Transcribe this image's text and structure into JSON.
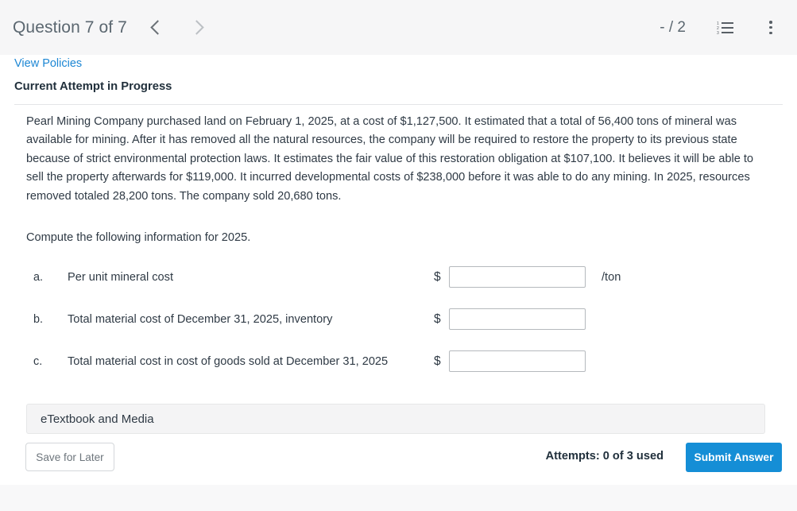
{
  "header": {
    "question_title": "Question 7 of 7",
    "prev_icon": "chevron-left-icon",
    "next_icon": "chevron-right-icon",
    "score": "- / 2",
    "list_icon": "numbered-list-icon",
    "menu_icon": "more-vertical-icon"
  },
  "card": {
    "view_policies": "View Policies",
    "attempt_status": "Current Attempt in Progress",
    "problem": "Pearl Mining Company purchased land on February 1, 2025, at a cost of $1,127,500. It estimated that a total of 56,400 tons of mineral was available for mining. After it has removed all the natural resources, the company will be required to restore the property to its previous state because of strict environmental protection laws. It estimates the fair value of this restoration obligation at $107,100. It believes it will be able to sell the property afterwards for $119,000. It incurred developmental costs of $238,000 before it was able to do any mining. In 2025, resources removed totaled 28,200 tons. The company sold 20,680 tons.",
    "instruction": "Compute the following information for 2025."
  },
  "questions": [
    {
      "label": "a.",
      "text": "Per unit mineral cost",
      "currency": "$",
      "value": "",
      "placeholder": "",
      "unit": "/ton"
    },
    {
      "label": "b.",
      "text": "Total material cost of December 31, 2025, inventory",
      "currency": "$",
      "value": "",
      "placeholder": "",
      "unit": ""
    },
    {
      "label": "c.",
      "text": "Total material cost in cost of goods sold at December 31, 2025",
      "currency": "$",
      "value": "",
      "placeholder": "",
      "unit": ""
    }
  ],
  "footer": {
    "etextbook_label": "eTextbook and Media",
    "save_for_later": "Save for Later",
    "attempts": "Attempts: 0 of 3 used",
    "submit": "Submit Answer"
  },
  "colors": {
    "accent_blue": "#158ed6",
    "link_blue": "#1d87d4",
    "header_bg": "#f6f6f7",
    "page_bg": "#f8f8f9",
    "text": "#2f3a45"
  }
}
